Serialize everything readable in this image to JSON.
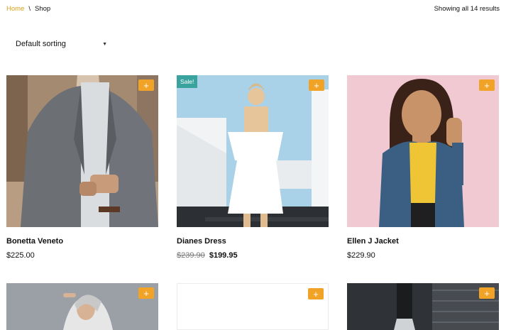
{
  "breadcrumb": {
    "home": "Home",
    "separator": "\\",
    "current": "Shop"
  },
  "results_text": "Showing all 14 results",
  "sorting": {
    "selected": "Default sorting",
    "caret": "▼"
  },
  "add_symbol": "+",
  "products": [
    {
      "name": "Bonetta Veneto",
      "price": "$225.00"
    },
    {
      "name": "Dianes Dress",
      "old_price": "$239.90",
      "price": "$199.95",
      "badge": "Sale!"
    },
    {
      "name": "Ellen J Jacket",
      "price": "$229.90"
    }
  ],
  "colors": {
    "accent": "#f0a326",
    "link": "#d9a21b",
    "sale_badge": "#3aa39d"
  },
  "icons": [
    "plus-icon",
    "caret-down-icon"
  ]
}
